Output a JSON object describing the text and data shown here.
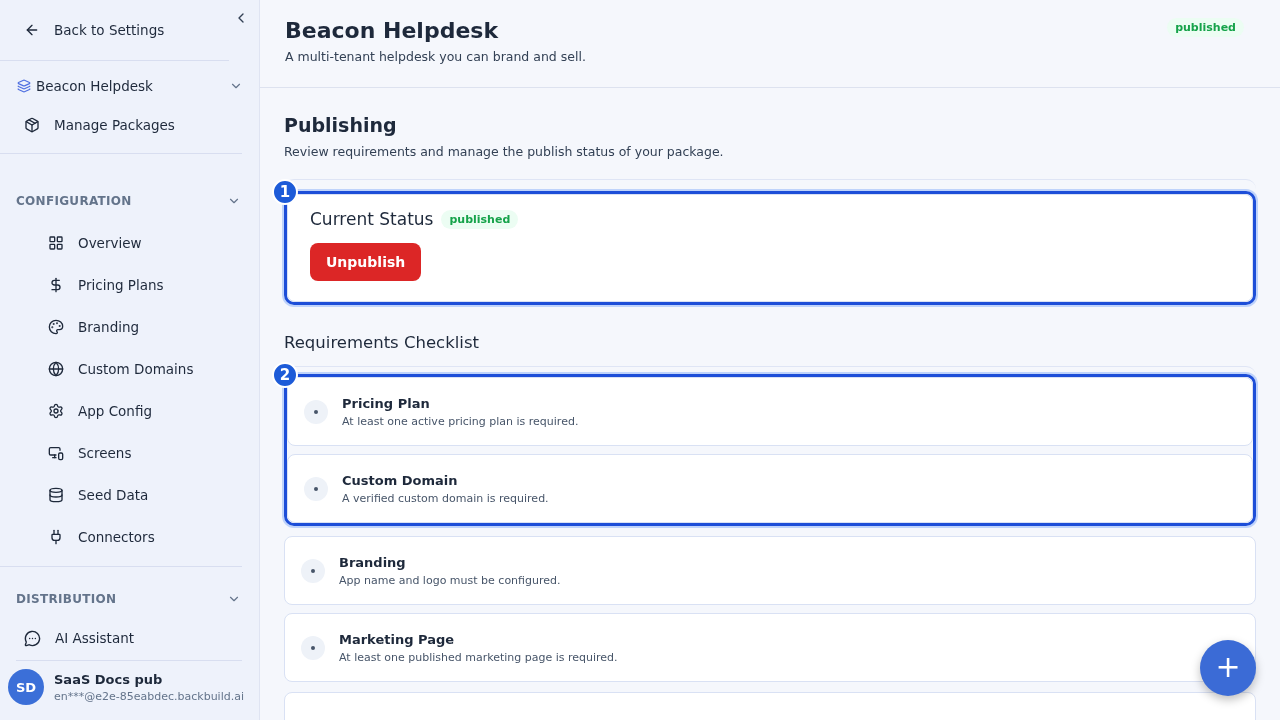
{
  "sidebar": {
    "back_link": "Back to Settings",
    "package": {
      "name": "Beacon Helpdesk",
      "expanded": true
    },
    "manage_link": "Manage Packages",
    "sections": [
      {
        "title": "CONFIGURATION",
        "expanded": true,
        "items": [
          {
            "label": "Overview"
          },
          {
            "label": "Pricing Plans"
          },
          {
            "label": "Branding"
          },
          {
            "label": "Custom Domains"
          },
          {
            "label": "App Config"
          },
          {
            "label": "Screens"
          },
          {
            "label": "Seed Data"
          },
          {
            "label": "Connectors"
          }
        ]
      },
      {
        "title": "DISTRIBUTION",
        "expanded": true
      }
    ],
    "assistant": "AI Assistant",
    "user": {
      "initials": "SD",
      "name": "SaaS Docs pub",
      "email": "en***@e2e-85eabdec.backbuild.ai"
    }
  },
  "header": {
    "title": "Beacon Helpdesk",
    "subtitle": "A multi-tenant helpdesk you can brand and sell.",
    "status": "published"
  },
  "publishing": {
    "title": "Publishing",
    "description": "Review requirements and manage the publish status of your package.",
    "status_card": {
      "marker": "1",
      "title": "Current Status",
      "status": "published",
      "action": "Unpublish"
    },
    "checklist_title": "Requirements Checklist",
    "checklist_groups": [
      {
        "marker": "2",
        "items": [
          {
            "title": "Pricing Plan",
            "description": "At least one active pricing plan is required."
          },
          {
            "title": "Custom Domain",
            "description": "A verified custom domain is required."
          }
        ]
      },
      {
        "items": [
          {
            "title": "Branding",
            "description": "App name and logo must be configured."
          },
          {
            "title": "Marketing Page",
            "description": "At least one published marketing page is required."
          }
        ]
      }
    ]
  },
  "fab": "+"
}
